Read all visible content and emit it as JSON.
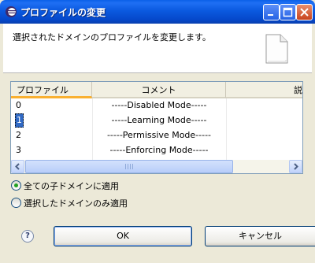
{
  "window": {
    "title": "プロファイルの変更",
    "title_icon": "eclipse-icon",
    "controls": [
      "minimize",
      "maximize",
      "close"
    ]
  },
  "header": {
    "description": "選択されたドメインのプロファイルを変更します。",
    "icon": "document-icon"
  },
  "table": {
    "columns": [
      "プロファイル",
      "コメント",
      "説"
    ],
    "rows": [
      {
        "id": "0",
        "comment": "-----Disabled Mode-----"
      },
      {
        "id": "1",
        "comment": "-----Learning Mode-----"
      },
      {
        "id": "2",
        "comment": "-----Permissive Mode-----"
      },
      {
        "id": "3",
        "comment": "-----Enforcing Mode-----"
      }
    ],
    "selected_row": 1
  },
  "options": [
    {
      "label": "全ての子ドメインに適用",
      "selected": true
    },
    {
      "label": "選択したドメインのみ適用",
      "selected": false
    }
  ],
  "buttons": {
    "help": "?",
    "ok": "OK",
    "cancel": "キャンセル"
  },
  "colors": {
    "title_bar": "#0b5ae0",
    "selection": "#316ac5",
    "radio_selected": "#21a121",
    "sort_indicator": "#f9b031"
  }
}
